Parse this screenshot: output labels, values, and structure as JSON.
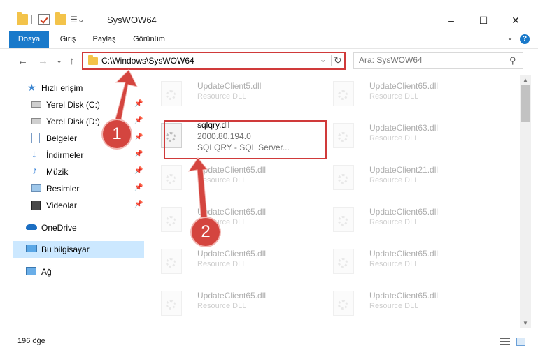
{
  "window": {
    "title": "SysWOW64",
    "minimize": "–",
    "maximize": "☐",
    "close": "✕"
  },
  "ribbon": {
    "tabs": [
      "Dosya",
      "Giriş",
      "Paylaş",
      "Görünüm"
    ],
    "help": "?",
    "collapse": "⌄"
  },
  "nav": {
    "back": "←",
    "forward": "→",
    "recent": "⌄",
    "up": "↑",
    "address": "C:\\Windows\\SysWOW64",
    "dropdown": "⌄",
    "refresh": "↻",
    "search_placeholder": "Ara: SysWOW64",
    "search_icon": "⚲"
  },
  "sidebar": {
    "items": [
      {
        "label": "Hızlı erişim",
        "icon": "star-icon"
      },
      {
        "label": "Yerel Disk (C:)",
        "icon": "drive-icon",
        "pinned": true
      },
      {
        "label": "Yerel Disk (D:)",
        "icon": "drive-icon",
        "pinned": true
      },
      {
        "label": "Belgeler",
        "icon": "documents-icon",
        "pinned": true
      },
      {
        "label": "İndirmeler",
        "icon": "download-icon",
        "pinned": true
      },
      {
        "label": "Müzik",
        "icon": "music-icon",
        "pinned": true
      },
      {
        "label": "Resimler",
        "icon": "pictures-icon",
        "pinned": true
      },
      {
        "label": "Videolar",
        "icon": "video-icon",
        "pinned": true
      },
      {
        "label": "OneDrive",
        "icon": "cloud-icon"
      },
      {
        "label": "Bu bilgisayar",
        "icon": "computer-icon",
        "selected": true
      },
      {
        "label": "Ağ",
        "icon": "network-icon"
      }
    ],
    "pin_glyph": "📌"
  },
  "files": [
    {
      "name": "UpdateClient5.dll",
      "desc": "Resource DLL",
      "faded": true
    },
    {
      "name": "UpdateClient65.dll",
      "desc": "Resource DLL",
      "faded": true
    },
    {
      "name": "sqlqry.dll",
      "version": "2000.80.194.0",
      "desc": "SQLQRY - SQL Server...",
      "faded": false
    },
    {
      "name": "UpdateClient63.dll",
      "desc": "Resource DLL",
      "faded": true
    },
    {
      "name": "UpdateClient65.dll",
      "desc": "Resource DLL",
      "faded": true
    },
    {
      "name": "UpdateClient21.dll",
      "desc": "Resource DLL",
      "faded": true
    },
    {
      "name": "UpdateClient65.dll",
      "desc": "Resource DLL",
      "faded": true
    },
    {
      "name": "UpdateClient65.dll",
      "desc": "Resource DLL",
      "faded": true
    },
    {
      "name": "UpdateClient65.dll",
      "desc": "Resource DLL",
      "faded": true
    },
    {
      "name": "UpdateClient65.dll",
      "desc": "Resource DLL",
      "faded": true
    },
    {
      "name": "UpdateClient65.dll",
      "desc": "Resource DLL",
      "faded": true
    },
    {
      "name": "UpdateClient65.dll",
      "desc": "Resource DLL",
      "faded": true
    }
  ],
  "status": {
    "count": "196 öğe"
  },
  "annotations": {
    "badge1": "1",
    "badge2": "2",
    "color": "#d4453f"
  },
  "colors": {
    "accent": "#1979ca",
    "selection": "#cce8ff",
    "highlight": "#d03a3a"
  }
}
